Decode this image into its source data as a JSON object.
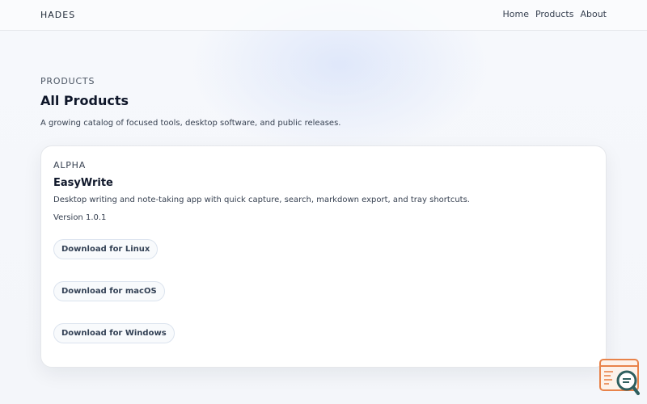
{
  "header": {
    "brand": "HADES",
    "nav": [
      {
        "label": "Home"
      },
      {
        "label": "Products"
      },
      {
        "label": "About"
      }
    ]
  },
  "hero": {
    "eyebrow": "PRODUCTS",
    "title": "All Products",
    "description": "A growing catalog of focused tools, desktop software, and public releases."
  },
  "product": {
    "badge": "ALPHA",
    "name": "EasyWrite",
    "description": "Desktop writing and note-taking app with quick capture, search, markdown export, and tray shortcuts.",
    "version": "Version 1.0.1",
    "downloads": [
      {
        "label": "Download for Linux"
      },
      {
        "label": "Download for macOS"
      },
      {
        "label": "Download for Windows"
      }
    ]
  },
  "widget": {
    "icon": "chat-search-icon",
    "accent_color": "#e8834a",
    "secondary_color": "#2f5f5f"
  }
}
